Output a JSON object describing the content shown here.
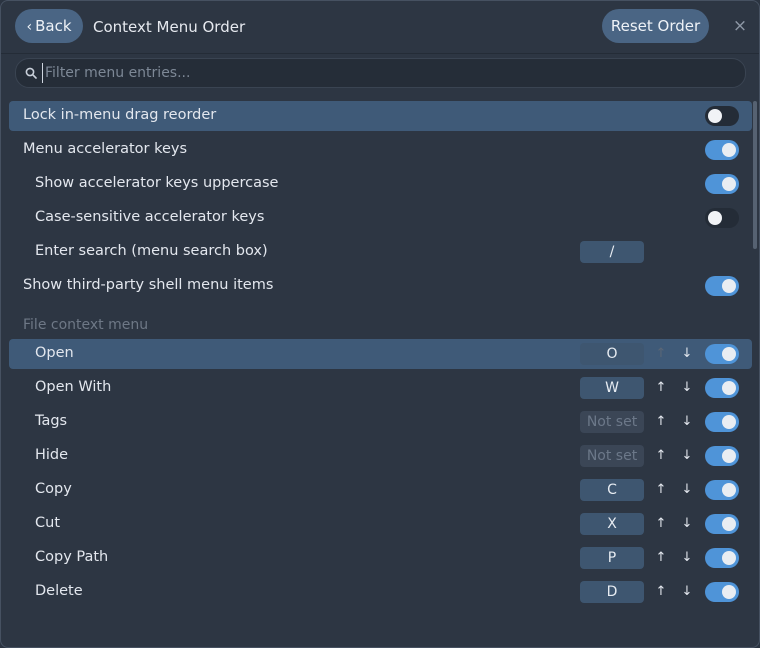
{
  "header": {
    "back_label": "Back",
    "title": "Context Menu Order",
    "reset_label": "Reset Order",
    "close_glyph": "×"
  },
  "search": {
    "placeholder": "Filter menu entries...",
    "value": ""
  },
  "settings": {
    "lock_drag": {
      "label": "Lock in-menu drag reorder",
      "on": false
    },
    "accelerator_keys": {
      "label": "Menu accelerator keys",
      "on": true
    },
    "accel_uppercase": {
      "label": "Show accelerator keys uppercase",
      "on": true
    },
    "accel_case_sensitive": {
      "label": "Case-sensitive accelerator keys",
      "on": false
    },
    "enter_search": {
      "label": "Enter search (menu search box)",
      "key": "/"
    },
    "third_party": {
      "label": "Show third-party shell menu items",
      "on": true
    }
  },
  "section": {
    "file_menu_title": "File context menu"
  },
  "arrows": {
    "up": "↑",
    "down": "↓"
  },
  "file_menu_items": [
    {
      "label": "Open",
      "key": "O",
      "enabled": true
    },
    {
      "label": "Open With",
      "key": "W",
      "enabled": true
    },
    {
      "label": "Tags",
      "key": "Not set",
      "enabled": true
    },
    {
      "label": "Hide",
      "key": "Not set",
      "enabled": true
    },
    {
      "label": "Copy",
      "key": "C",
      "enabled": true
    },
    {
      "label": "Cut",
      "key": "X",
      "enabled": true
    },
    {
      "label": "Copy Path",
      "key": "P",
      "enabled": true
    },
    {
      "label": "Delete",
      "key": "D",
      "enabled": true
    }
  ],
  "colors": {
    "accent": "#4f94d8",
    "highlight_row": "#3f5a78",
    "background": "#2d3643"
  }
}
